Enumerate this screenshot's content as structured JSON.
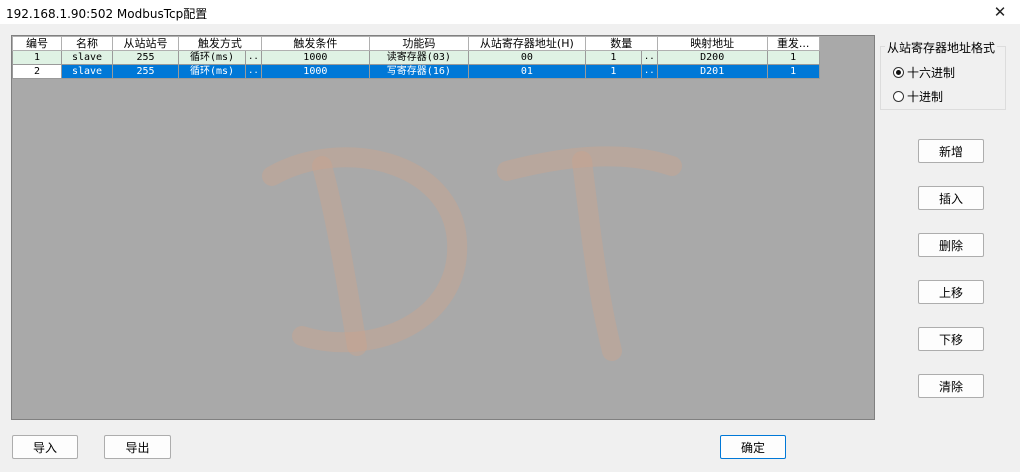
{
  "window": {
    "title": "192.168.1.90:502 ModbusTcp配置",
    "close_glyph": "✕"
  },
  "table": {
    "columns": [
      "编号",
      "名称",
      "从站站号",
      "触发方式",
      "",
      "触发条件",
      "功能码",
      "从站寄存器地址(H)",
      "数量",
      "",
      "映射地址",
      "重发..."
    ],
    "rows": [
      {
        "no": "1",
        "name": "slave",
        "station": "255",
        "trigger": "循环(ms)",
        "dots1": "..",
        "condition": "1000",
        "func": "读寄存器(03)",
        "reg_addr": "00",
        "count": "1",
        "dots2": "..",
        "map_addr": "D200",
        "retry": "1"
      },
      {
        "no": "2",
        "name": "slave",
        "station": "255",
        "trigger": "循环(ms)",
        "dots1": "..",
        "condition": "1000",
        "func": "写寄存器(16)",
        "reg_addr": "01",
        "count": "1",
        "dots2": "..",
        "map_addr": "D201",
        "retry": "1"
      }
    ],
    "selected_row": 2
  },
  "format_group": {
    "title": "从站寄存器地址格式",
    "options": [
      {
        "label": "十六进制",
        "checked": true
      },
      {
        "label": "十进制",
        "checked": false
      }
    ]
  },
  "side_buttons": {
    "add": "新增",
    "insert": "插入",
    "delete": "删除",
    "move_up": "上移",
    "move_down": "下移",
    "clear": "清除"
  },
  "bottom_buttons": {
    "import": "导入",
    "export": "导出",
    "ok": "确定"
  },
  "colors": {
    "grid_bg": "#a9a9a9",
    "row_highlight": "#dff2e4",
    "selection": "#0078d7",
    "watermark": "#c9a58e"
  }
}
